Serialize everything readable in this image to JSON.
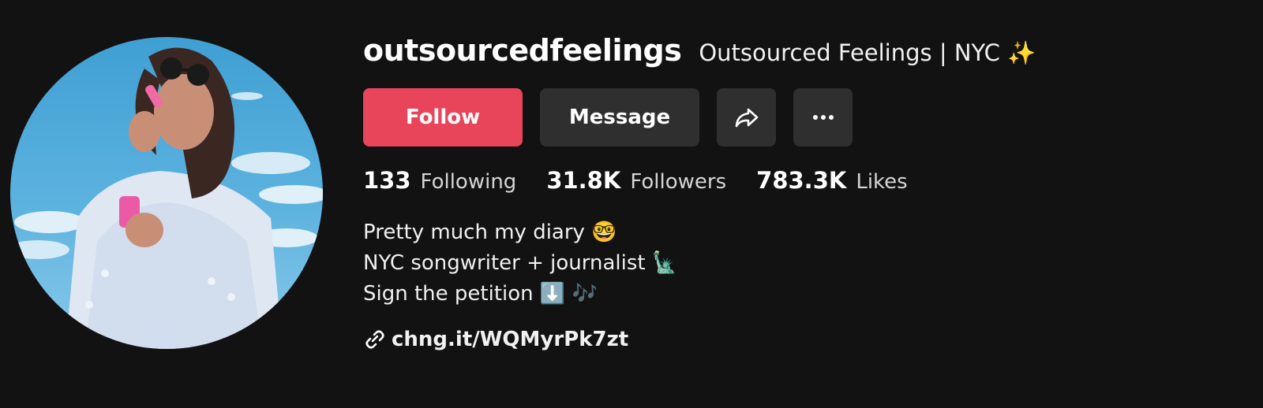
{
  "profile": {
    "username": "outsourcedfeelings",
    "display_name": "Outsourced Feelings | NYC ✨"
  },
  "actions": {
    "follow_label": "Follow",
    "message_label": "Message",
    "share_icon": "share-icon",
    "more_icon": "more-icon"
  },
  "stats": [
    {
      "value": "133",
      "label": "Following"
    },
    {
      "value": "31.8K",
      "label": "Followers"
    },
    {
      "value": "783.3K",
      "label": "Likes"
    }
  ],
  "bio": [
    "Pretty much my diary 🤓",
    "NYC songwriter + journalist 🗽",
    "Sign the petition ⬇️ 🎶"
  ],
  "link": {
    "icon": "link-icon",
    "text": "chng.it/WQMyrPk7zt"
  },
  "colors": {
    "background": "#121212",
    "follow_button": "#e8455b",
    "secondary_button": "#2f2f2f"
  }
}
